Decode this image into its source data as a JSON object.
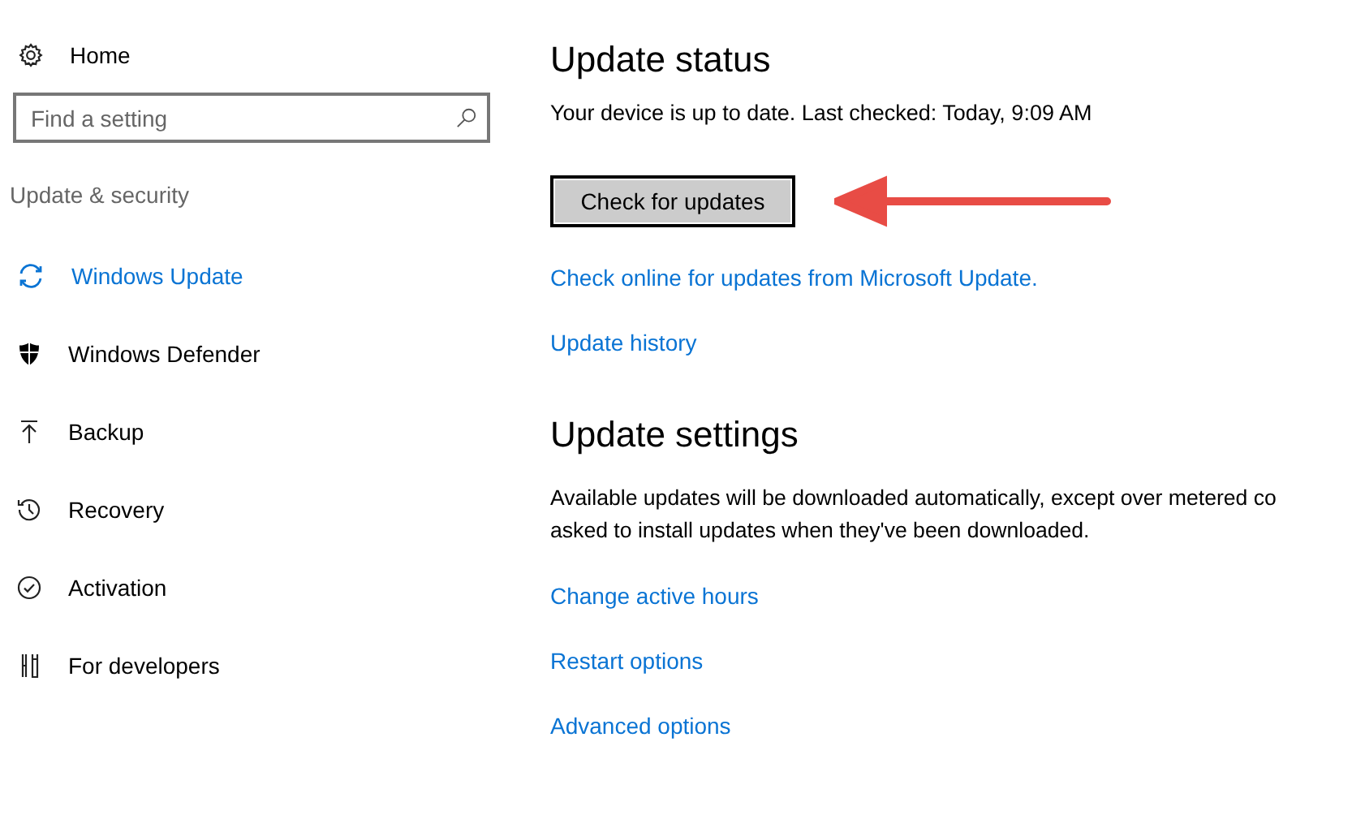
{
  "sidebar": {
    "home": "Home",
    "search": {
      "placeholder": "Find a setting"
    },
    "section": "Update & security",
    "items": [
      {
        "label": "Windows Update",
        "selected": true
      },
      {
        "label": "Windows Defender",
        "selected": false
      },
      {
        "label": "Backup",
        "selected": false
      },
      {
        "label": "Recovery",
        "selected": false
      },
      {
        "label": "Activation",
        "selected": false
      },
      {
        "label": "For developers",
        "selected": false
      }
    ]
  },
  "status": {
    "title": "Update status",
    "message": "Your device is up to date. Last checked: Today, 9:09 AM",
    "button": "Check for updates",
    "links": [
      "Check online for updates from Microsoft Update.",
      "Update history"
    ]
  },
  "settings": {
    "title": "Update settings",
    "paragraph_lines": [
      "Available updates will be downloaded automatically, except over metered co",
      "asked to install updates when they've been downloaded."
    ],
    "links": [
      "Change active hours",
      "Restart options",
      "Advanced options"
    ]
  }
}
